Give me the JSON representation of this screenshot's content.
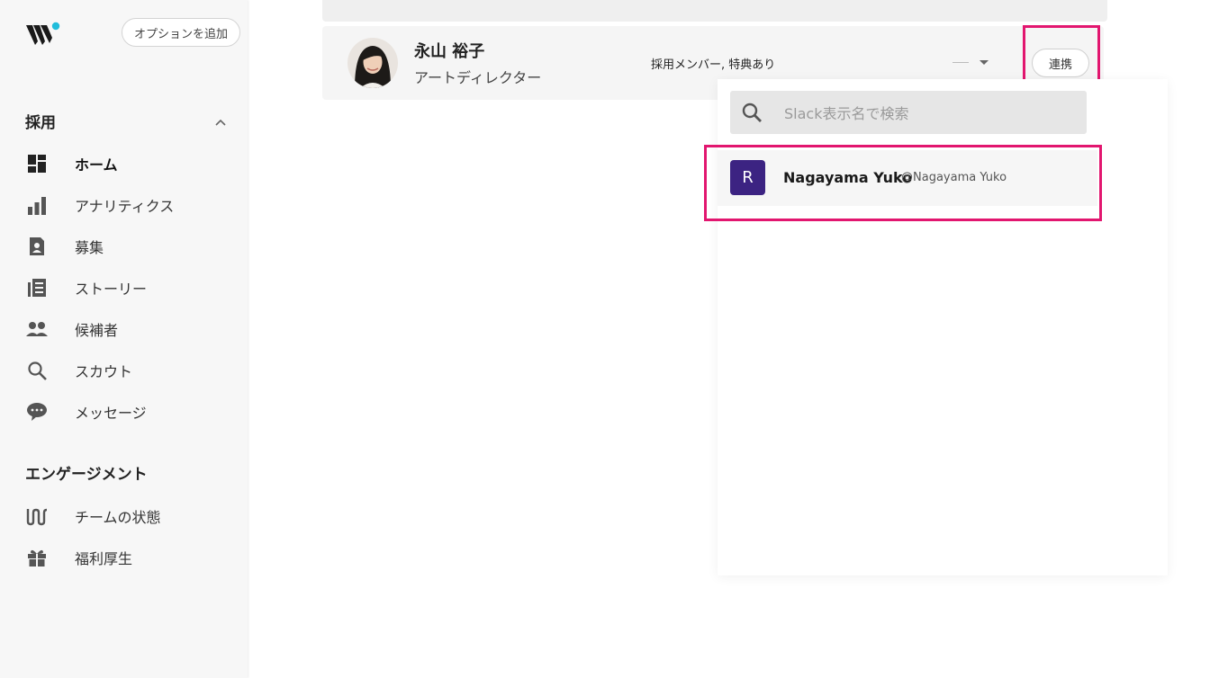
{
  "sidebar": {
    "logo_icon": "wantedly-logo-icon",
    "option_button": "オプションを追加",
    "recruit_section": {
      "title": "採用",
      "caret_icon": "chevron-up-icon"
    },
    "recruit_items": [
      {
        "label": "ホーム",
        "icon": "dashboard-icon",
        "active": true
      },
      {
        "label": "アナリティクス",
        "icon": "bar-chart-icon",
        "active": false
      },
      {
        "label": "募集",
        "icon": "badge-document-icon",
        "active": false
      },
      {
        "label": "ストーリー",
        "icon": "article-icon",
        "active": false
      },
      {
        "label": "候補者",
        "icon": "people-icon",
        "active": false
      },
      {
        "label": "スカウト",
        "icon": "search-icon",
        "active": false
      },
      {
        "label": "メッセージ",
        "icon": "chat-bubble-icon",
        "active": false
      }
    ],
    "engagement_section": {
      "title": "エンゲージメント"
    },
    "engagement_items": [
      {
        "label": "チームの状態",
        "icon": "pulse-icon",
        "active": false
      },
      {
        "label": "福利厚生",
        "icon": "gift-icon",
        "active": false
      }
    ]
  },
  "member": {
    "name": "永山 裕子",
    "title": "アートディレクター",
    "tags": "採用メンバー, 特典あり",
    "select_value": "—",
    "link_button": "連携"
  },
  "slack_dropdown": {
    "search_placeholder": "Slack表示名で検索",
    "results": [
      {
        "avatar_letter": "R",
        "display_name": "Nagayama Yuko",
        "handle": "@Nagayama Yuko"
      }
    ]
  },
  "colors": {
    "highlight": "#e2166f",
    "slack_avatar": "#3c2382",
    "logo_dot": "#21bddb"
  }
}
